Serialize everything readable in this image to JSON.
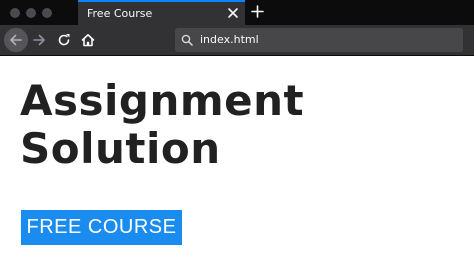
{
  "browser": {
    "tab": {
      "title": "Free Course"
    },
    "address_bar": {
      "url": "index.html"
    },
    "icons": {
      "close_tab": "close-icon",
      "new_tab": "plus-icon",
      "back": "arrow-left-icon",
      "forward": "arrow-right-icon",
      "reload": "reload-icon",
      "home": "home-icon",
      "search": "search-icon"
    },
    "colors": {
      "chrome_dark": "#0c0c0d",
      "toolbar": "#323234",
      "active_tab_highlight": "#0a84ff"
    }
  },
  "page": {
    "heading_lines": [
      "Assignment",
      "Solution"
    ],
    "cta_label": "FREE COURSE",
    "colors": {
      "heading": "#212121",
      "cta_background": "#1a8cf0",
      "cta_text": "#ffffff"
    }
  }
}
